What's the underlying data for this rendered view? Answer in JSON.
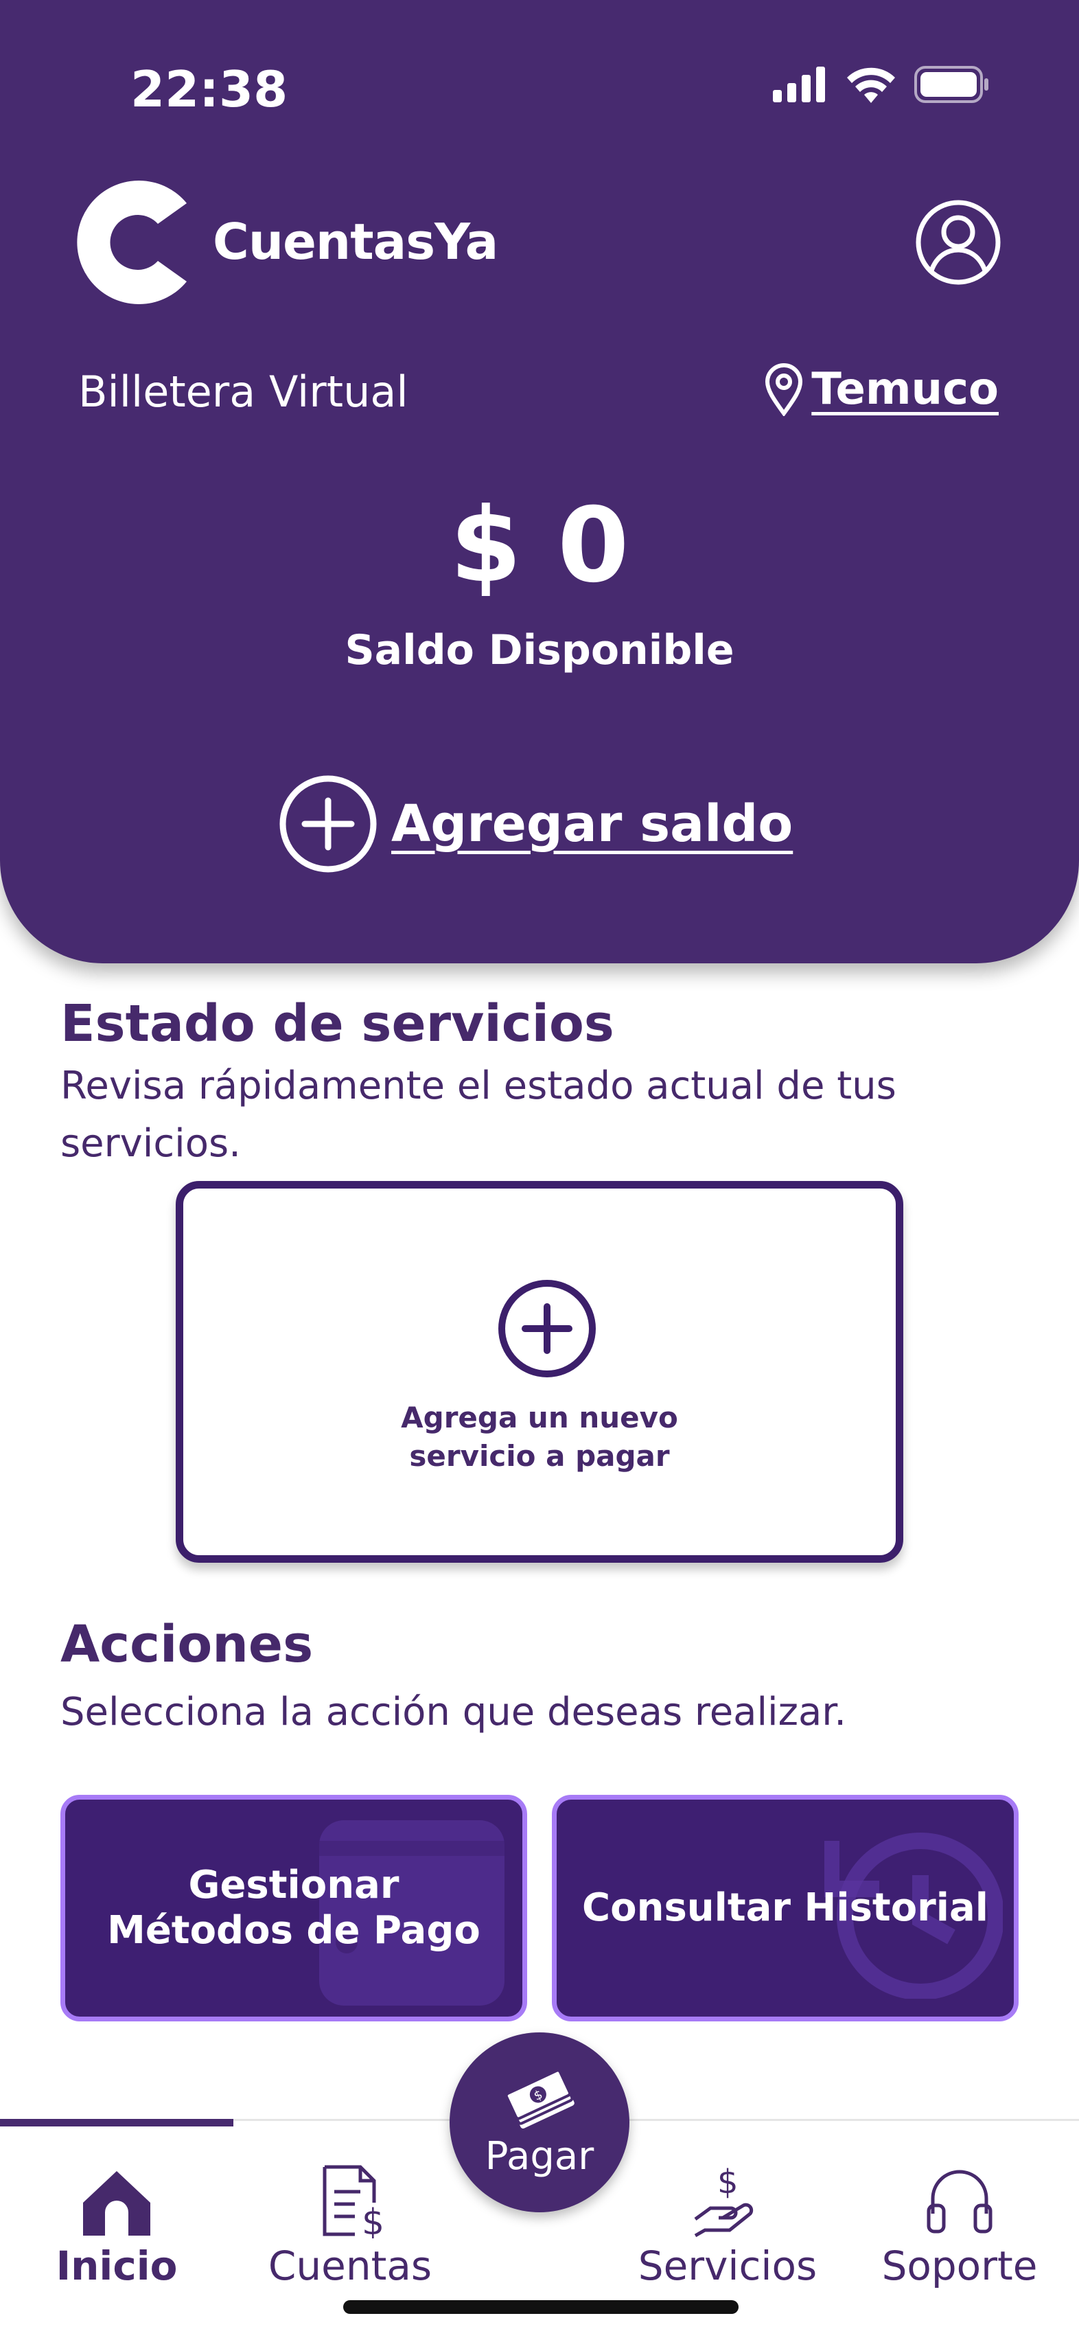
{
  "status_bar": {
    "time": "22:38",
    "icons": [
      "cellular-signal-icon",
      "wifi-icon",
      "battery-icon"
    ]
  },
  "header": {
    "app_name": "CuentasYa",
    "wallet_label": "Billetera Virtual",
    "location": "Temuco",
    "balance": "$ 0",
    "balance_label": "Saldo Disponible",
    "add_balance_label": "Agregar saldo",
    "icons": [
      "logo-c-icon",
      "profile-icon",
      "location-pin-icon",
      "plus-circle-icon"
    ]
  },
  "services": {
    "title": "Estado de servicios",
    "description": "Revisa rápidamente el estado actual de tus servicios.",
    "add_card_line1": "Agrega un nuevo",
    "add_card_line2": "servicio a pagar"
  },
  "actions": {
    "title": "Acciones",
    "description": "Selecciona la acción que deseas realizar.",
    "manage_payments_line1": "Gestionar",
    "manage_payments_line2": "Métodos de Pago",
    "history_label": "Consultar Historial"
  },
  "nav": {
    "home": "Inicio",
    "accounts": "Cuentas",
    "pay": "Pagar",
    "services": "Servicios",
    "support": "Soporte",
    "active": "home"
  },
  "colors": {
    "primary": "#472a6f",
    "text": "#46296b",
    "action_bg": "#3e1f72",
    "action_border": "#a77bf6",
    "white": "#ffffff"
  }
}
